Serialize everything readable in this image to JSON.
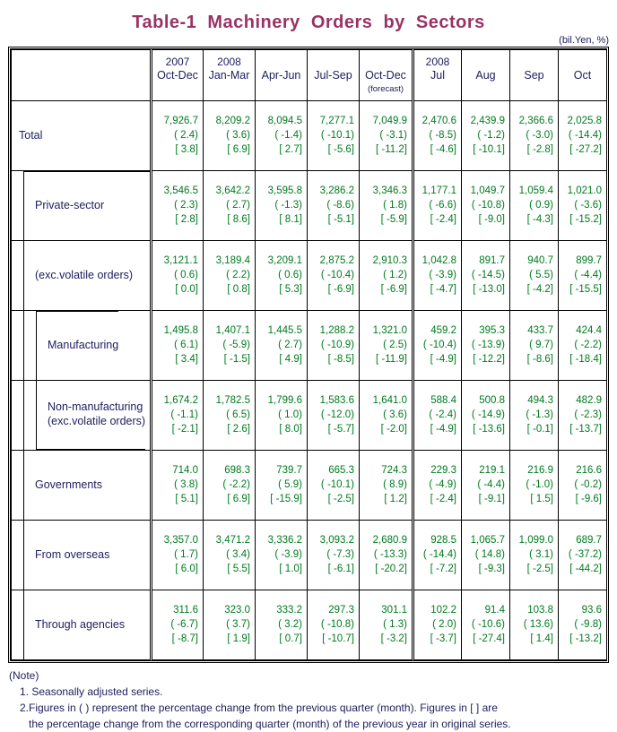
{
  "title": "Table-1  Machinery  Orders  by  Sectors",
  "unit": "(bil.Yen, %)",
  "colors": {
    "title": "#993366",
    "label_text": "#202060",
    "value_text": "#007a1f"
  },
  "header": {
    "label_col": "",
    "columns": [
      {
        "year": "2007",
        "period": "Oct-Dec",
        "sub": ""
      },
      {
        "year": "2008",
        "period": "Jan-Mar",
        "sub": ""
      },
      {
        "year": "",
        "period": "Apr-Jun",
        "sub": ""
      },
      {
        "year": "",
        "period": "Jul-Sep",
        "sub": ""
      },
      {
        "year": "",
        "period": "Oct-Dec",
        "sub": "(forecast)"
      },
      {
        "year": "2008",
        "period": "Jul",
        "sub": ""
      },
      {
        "year": "",
        "period": "Aug",
        "sub": ""
      },
      {
        "year": "",
        "period": "Sep",
        "sub": ""
      },
      {
        "year": "",
        "period": "Oct",
        "sub": ""
      }
    ]
  },
  "rows": [
    {
      "label": "Total",
      "label2": "",
      "indent": 0,
      "values": [
        {
          "level": "7,926.7",
          "qoq": "( 2.4)",
          "yoy": "[ 3.8]"
        },
        {
          "level": "8,209.2",
          "qoq": "( 3.6)",
          "yoy": "[ 6.9]"
        },
        {
          "level": "8,094.5",
          "qoq": "( -1.4)",
          "yoy": "[ 2.7]"
        },
        {
          "level": "7,277.1",
          "qoq": "( -10.1)",
          "yoy": "[ -5.6]"
        },
        {
          "level": "7,049.9",
          "qoq": "( -3.1)",
          "yoy": "[ -11.2]"
        },
        {
          "level": "2,470.6",
          "qoq": "( -8.5)",
          "yoy": "[ -4.6]"
        },
        {
          "level": "2,439.9",
          "qoq": "( -1.2)",
          "yoy": "[ -10.1]"
        },
        {
          "level": "2,366.6",
          "qoq": "( -3.0)",
          "yoy": "[ -2.8]"
        },
        {
          "level": "2,025.8",
          "qoq": "( -14.4)",
          "yoy": "[ -27.2]"
        }
      ]
    },
    {
      "label": "Private-sector",
      "label2": "",
      "indent": 1,
      "values": [
        {
          "level": "3,546.5",
          "qoq": "( 2.3)",
          "yoy": "[ 2.8]"
        },
        {
          "level": "3,642.2",
          "qoq": "( 2.7)",
          "yoy": "[ 8.6]"
        },
        {
          "level": "3,595.8",
          "qoq": "( -1.3)",
          "yoy": "[ 8.1]"
        },
        {
          "level": "3,286.2",
          "qoq": "( -8.6)",
          "yoy": "[ -5.1]"
        },
        {
          "level": "3,346.3",
          "qoq": "( 1.8)",
          "yoy": "[ -5.9]"
        },
        {
          "level": "1,177.1",
          "qoq": "( -6.6)",
          "yoy": "[ -2.4]"
        },
        {
          "level": "1,049.7",
          "qoq": "( -10.8)",
          "yoy": "[ -9.0]"
        },
        {
          "level": "1,059.4",
          "qoq": "( 0.9)",
          "yoy": "[ -4.3]"
        },
        {
          "level": "1,021.0",
          "qoq": "( -3.6)",
          "yoy": "[ -15.2]"
        }
      ]
    },
    {
      "label": "(exc.volatile orders)",
      "label2": "",
      "indent": 1,
      "values": [
        {
          "level": "3,121.1",
          "qoq": "( 0.6)",
          "yoy": "[ 0.0]"
        },
        {
          "level": "3,189.4",
          "qoq": "( 2.2)",
          "yoy": "[ 0.8]"
        },
        {
          "level": "3,209.1",
          "qoq": "( 0.6)",
          "yoy": "[ 5.3]"
        },
        {
          "level": "2,875.2",
          "qoq": "( -10.4)",
          "yoy": "[ -6.9]"
        },
        {
          "level": "2,910.3",
          "qoq": "( 1.2)",
          "yoy": "[ -6.9]"
        },
        {
          "level": "1,042.8",
          "qoq": "( -3.9)",
          "yoy": "[ -4.7]"
        },
        {
          "level": "891.7",
          "qoq": "( -14.5)",
          "yoy": "[ -13.0]"
        },
        {
          "level": "940.7",
          "qoq": "( 5.5)",
          "yoy": "[ -4.2]"
        },
        {
          "level": "899.7",
          "qoq": "( -4.4)",
          "yoy": "[ -15.5]"
        }
      ]
    },
    {
      "label": "Manufacturing",
      "label2": "",
      "indent": 2,
      "values": [
        {
          "level": "1,495.8",
          "qoq": "( 6.1)",
          "yoy": "[ 3.4]"
        },
        {
          "level": "1,407.1",
          "qoq": "( -5.9)",
          "yoy": "[ -1.5]"
        },
        {
          "level": "1,445.5",
          "qoq": "( 2.7)",
          "yoy": "[ 4.9]"
        },
        {
          "level": "1,288.2",
          "qoq": "( -10.9)",
          "yoy": "[ -8.5]"
        },
        {
          "level": "1,321.0",
          "qoq": "( 2.5)",
          "yoy": "[ -11.9]"
        },
        {
          "level": "459.2",
          "qoq": "( -10.4)",
          "yoy": "[ -4.9]"
        },
        {
          "level": "395.3",
          "qoq": "( -13.9)",
          "yoy": "[ -12.2]"
        },
        {
          "level": "433.7",
          "qoq": "( 9.7)",
          "yoy": "[ -8.6]"
        },
        {
          "level": "424.4",
          "qoq": "( -2.2)",
          "yoy": "[ -18.4]"
        }
      ]
    },
    {
      "label": "Non-manufacturing",
      "label2": "(exc.volatile orders)",
      "indent": 2,
      "values": [
        {
          "level": "1,674.2",
          "qoq": "( -1.1)",
          "yoy": "[ -2.1]"
        },
        {
          "level": "1,782.5",
          "qoq": "( 6.5)",
          "yoy": "[ 2.6]"
        },
        {
          "level": "1,799.6",
          "qoq": "( 1.0)",
          "yoy": "[ 8.0]"
        },
        {
          "level": "1,583.6",
          "qoq": "( -12.0)",
          "yoy": "[ -5.7]"
        },
        {
          "level": "1,641.0",
          "qoq": "( 3.6)",
          "yoy": "[ -2.0]"
        },
        {
          "level": "588.4",
          "qoq": "( -2.4)",
          "yoy": "[ -4.9]"
        },
        {
          "level": "500.8",
          "qoq": "( -14.9)",
          "yoy": "[ -13.6]"
        },
        {
          "level": "494.3",
          "qoq": "( -1.3)",
          "yoy": "[ -0.1]"
        },
        {
          "level": "482.9",
          "qoq": "( -2.3)",
          "yoy": "[ -13.7]"
        }
      ]
    },
    {
      "label": "Governments",
      "label2": "",
      "indent": 1,
      "values": [
        {
          "level": "714.0",
          "qoq": "( 3.8)",
          "yoy": "[ 5.1]"
        },
        {
          "level": "698.3",
          "qoq": "( -2.2)",
          "yoy": "[ 6.9]"
        },
        {
          "level": "739.7",
          "qoq": "( 5.9)",
          "yoy": "[ -15.9]"
        },
        {
          "level": "665.3",
          "qoq": "( -10.1)",
          "yoy": "[ -2.5]"
        },
        {
          "level": "724.3",
          "qoq": "( 8.9)",
          "yoy": "[ 1.2]"
        },
        {
          "level": "229.3",
          "qoq": "( -4.9)",
          "yoy": "[ -2.4]"
        },
        {
          "level": "219.1",
          "qoq": "( -4.4)",
          "yoy": "[ -9.1]"
        },
        {
          "level": "216.9",
          "qoq": "( -1.0)",
          "yoy": "[ 1.5]"
        },
        {
          "level": "216.6",
          "qoq": "( -0.2)",
          "yoy": "[ -9.6]"
        }
      ]
    },
    {
      "label": "From overseas",
      "label2": "",
      "indent": 1,
      "values": [
        {
          "level": "3,357.0",
          "qoq": "( 1.7)",
          "yoy": "[ 6.0]"
        },
        {
          "level": "3,471.2",
          "qoq": "( 3.4)",
          "yoy": "[ 5.5]"
        },
        {
          "level": "3,336.2",
          "qoq": "( -3.9)",
          "yoy": "[ 1.0]"
        },
        {
          "level": "3,093.2",
          "qoq": "( -7.3)",
          "yoy": "[ -6.1]"
        },
        {
          "level": "2,680.9",
          "qoq": "( -13.3)",
          "yoy": "[ -20.2]"
        },
        {
          "level": "928.5",
          "qoq": "( -14.4)",
          "yoy": "[ -7.2]"
        },
        {
          "level": "1,065.7",
          "qoq": "( 14.8)",
          "yoy": "[ -9.3]"
        },
        {
          "level": "1,099.0",
          "qoq": "( 3.1)",
          "yoy": "[ -2.5]"
        },
        {
          "level": "689.7",
          "qoq": "( -37.2)",
          "yoy": "[ -44.2]"
        }
      ]
    },
    {
      "label": "Through agencies",
      "label2": "",
      "indent": 1,
      "values": [
        {
          "level": "311.6",
          "qoq": "( -6.7)",
          "yoy": "[ -8.7]"
        },
        {
          "level": "323.0",
          "qoq": "( 3.7)",
          "yoy": "[ 1.9]"
        },
        {
          "level": "333.2",
          "qoq": "( 3.2)",
          "yoy": "[ 0.7]"
        },
        {
          "level": "297.3",
          "qoq": "( -10.8)",
          "yoy": "[ -10.7]"
        },
        {
          "level": "301.1",
          "qoq": "( 1.3)",
          "yoy": "[ -3.2]"
        },
        {
          "level": "102.2",
          "qoq": "( 2.0)",
          "yoy": "[ -3.7]"
        },
        {
          "level": "91.4",
          "qoq": "( -10.6)",
          "yoy": "[ -27.4]"
        },
        {
          "level": "103.8",
          "qoq": "( 13.6)",
          "yoy": "[ 1.4]"
        },
        {
          "level": "93.6",
          "qoq": "( -9.8)",
          "yoy": "[ -13.2]"
        }
      ]
    }
  ],
  "notes": {
    "head": "(Note)",
    "item1": "1. Seasonally adjusted series.",
    "item2": "2.Figures in ( ) represent the percentage change from the previous quarter (month). Figures in [ ] are",
    "item2_cont": "the percentage change from the corresponding quarter (month) of the previous year in original series."
  }
}
